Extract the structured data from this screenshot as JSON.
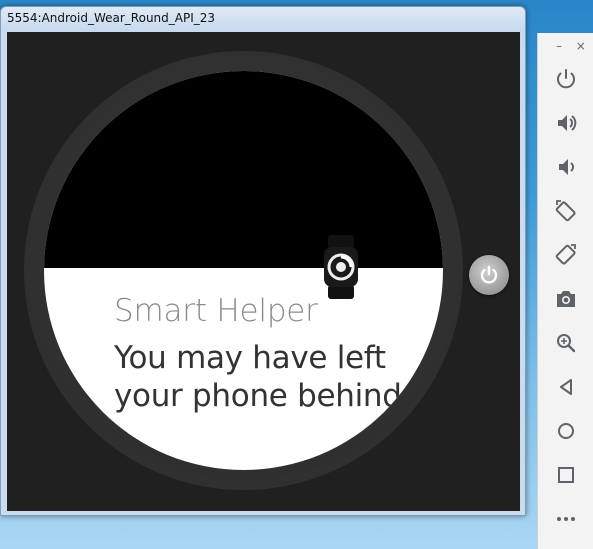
{
  "window": {
    "title": "5554:Android_Wear_Round_API_23"
  },
  "notification": {
    "title": "Smart Helper",
    "body_line1": "You may have left",
    "body_line2": "your phone behind."
  },
  "toolbar": {
    "window_controls": {
      "minimize": "–",
      "close": "×"
    },
    "buttons": [
      "power-icon",
      "volume-up-icon",
      "volume-down-icon",
      "rotate-left-icon",
      "rotate-right-icon",
      "camera-icon",
      "zoom-icon",
      "back-icon",
      "home-icon",
      "overview-icon",
      "more-icon"
    ]
  },
  "colors": {
    "toolbar_icon": "#5f6368",
    "watch_bezel": "#333333",
    "face_top": "#000000",
    "face_bottom": "#ffffff"
  }
}
